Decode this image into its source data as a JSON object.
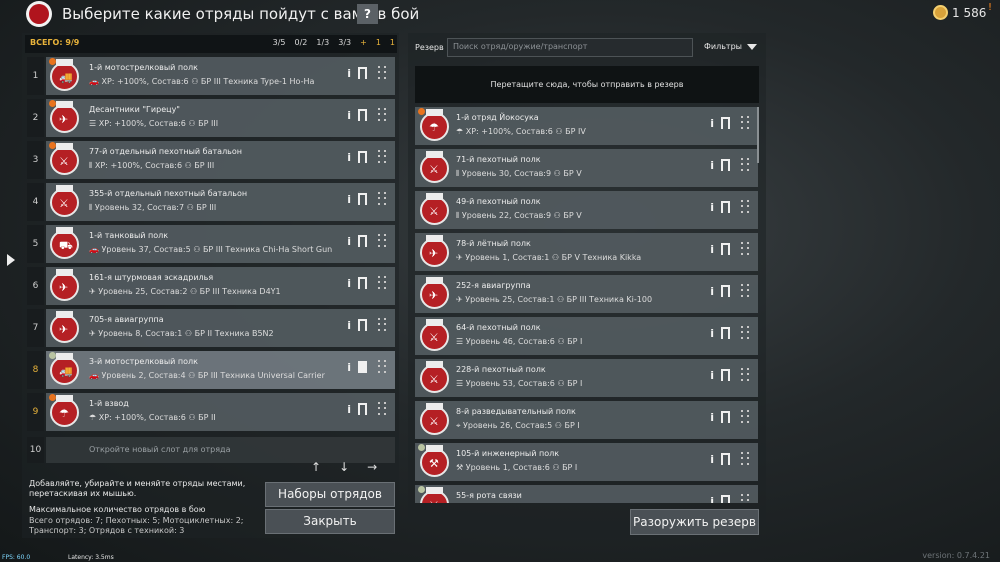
{
  "header": {
    "title": "Выберите какие отряды пойдут с вами в бой",
    "help": "?",
    "gold": "1 586",
    "warning": "!"
  },
  "squads": {
    "total": "ВСЕГО: 9/9",
    "counts": [
      {
        "icon": "infantry-icon",
        "value": "3/5"
      },
      {
        "icon": "paratrooper-icon",
        "value": "0/2"
      },
      {
        "icon": "vehicle-icon",
        "value": "1/3"
      },
      {
        "icon": "tank-icon",
        "value": "3/3"
      },
      {
        "icon": "plus-icon",
        "value": "+"
      },
      {
        "icon": "truck-icon",
        "value": "1"
      },
      {
        "icon": "bar-icon",
        "value": "1"
      }
    ],
    "rows": [
      {
        "num": "1",
        "name": "1-й мотострелковый полк",
        "sub": "🚗 XP: +100%, Состав:6 ⚇ БР III  Техника Type-1 Ho-Ha",
        "badge": "orange",
        "icon": "🚚",
        "selected": false,
        "gold": false
      },
      {
        "num": "2",
        "name": "Десантники \"Гирецу\"",
        "sub": "☰ XP: +100%, Состав:6 ⚇ БР III",
        "badge": "orange",
        "icon": "✈",
        "selected": false,
        "gold": false
      },
      {
        "num": "3",
        "name": "77-й отдельный пехотный батальон",
        "sub": "⫴ XP: +100%, Состав:6 ⚇ БР III",
        "badge": "orange",
        "icon": "⚔",
        "selected": false,
        "gold": false
      },
      {
        "num": "4",
        "name": "355-й отдельный пехотный батальон",
        "sub": "⫴ Уровень 32, Состав:7 ⚇ БР III",
        "badge": "",
        "icon": "⚔",
        "selected": false,
        "gold": false
      },
      {
        "num": "5",
        "name": "1-й танковый полк",
        "sub": "🚗 Уровень 37, Состав:5 ⚇ БР III  Техника Chi-Ha Short Gun",
        "badge": "",
        "icon": "⛟",
        "selected": false,
        "gold": false
      },
      {
        "num": "6",
        "name": "161-я штурмовая эскадрилья",
        "sub": "✈ Уровень 25, Состав:2 ⚇ БР III  Техника D4Y1",
        "badge": "",
        "icon": "✈",
        "selected": false,
        "gold": false
      },
      {
        "num": "7",
        "name": "705-я авиагруппа",
        "sub": "✈ Уровень 8, Состав:1 ⚇ БР II  Техника B5N2",
        "badge": "",
        "icon": "✈",
        "selected": false,
        "gold": false
      },
      {
        "num": "8",
        "name": "3-й мотострелковый полк",
        "sub": "🚗 Уровень 2, Состав:4 ⚇ БР III  Техника Universal Carrier",
        "badge": "green",
        "icon": "🚚",
        "selected": true,
        "gold": true
      },
      {
        "num": "9",
        "name": "1-й взвод",
        "sub": "☂ XP: +100%, Состав:6 ⚇ БР II",
        "badge": "orange",
        "icon": "☂",
        "selected": false,
        "gold": true
      }
    ],
    "empty_slot": {
      "num": "10",
      "text": "Откройте новый слот для отряда"
    },
    "hint": "Добавляйте, убирайте и меняйте отряды местами, перетаскивая их мышью.",
    "max": "Максимальное количество отрядов в бою",
    "stats": [
      "Всего отрядов: 7; Пехотных: 5; Мотоциклетных: 2;",
      "Транспорт: 3; Отрядов с техникой: 3"
    ],
    "presets_button": "Наборы отрядов",
    "close_button": "Закрыть"
  },
  "reserve": {
    "label": "Резерв",
    "search_placeholder": "Поиск отряд/оружие/транспорт",
    "filters": "Фильтры",
    "drop_zone": "Перетащите сюда, чтобы отправить в резерв",
    "rows": [
      {
        "name": "1-й отряд Йокосука",
        "sub": "☂ XP: +100%, Состав:6 ⚇ БР IV",
        "badge": "orange",
        "icon": "☂"
      },
      {
        "name": "71-й пехотный полк",
        "sub": "⫴ Уровень 30, Состав:9 ⚇ БР V",
        "badge": "",
        "icon": "⚔"
      },
      {
        "name": "49-й пехотный полк",
        "sub": "⫴ Уровень 22, Состав:9 ⚇ БР V",
        "badge": "",
        "icon": "⚔"
      },
      {
        "name": "78-й лётный полк",
        "sub": "✈ Уровень 1, Состав:1 ⚇ БР V  Техника Kikka",
        "badge": "",
        "icon": "✈"
      },
      {
        "name": "252-я авиагруппа",
        "sub": "✈ Уровень 25, Состав:1 ⚇ БР III  Техника Ki-100",
        "badge": "",
        "icon": "✈"
      },
      {
        "name": "64-й пехотный полк",
        "sub": "☰ Уровень 46, Состав:6 ⚇ БР I",
        "badge": "",
        "icon": "⚔"
      },
      {
        "name": "228-й пехотный полк",
        "sub": "☰ Уровень 53, Состав:6 ⚇ БР I",
        "badge": "",
        "icon": "⚔"
      },
      {
        "name": "8-й разведывательный полк",
        "sub": "⌖ Уровень 26, Состав:5 ⚇ БР I",
        "badge": "",
        "icon": "⚔"
      },
      {
        "name": "105-й инженерный полк",
        "sub": "⚒ Уровень 1, Состав:6 ⚇ БР I",
        "badge": "green",
        "icon": "⚒"
      },
      {
        "name": "55-я рота связи",
        "sub": "",
        "badge": "green",
        "icon": "⚔"
      }
    ],
    "disarm_button": "Разоружить резерв"
  },
  "footer": {
    "fps": "FPS: 60.0",
    "latency": "Latency: 3.5ms",
    "version": "version: 0.7.4.21"
  }
}
